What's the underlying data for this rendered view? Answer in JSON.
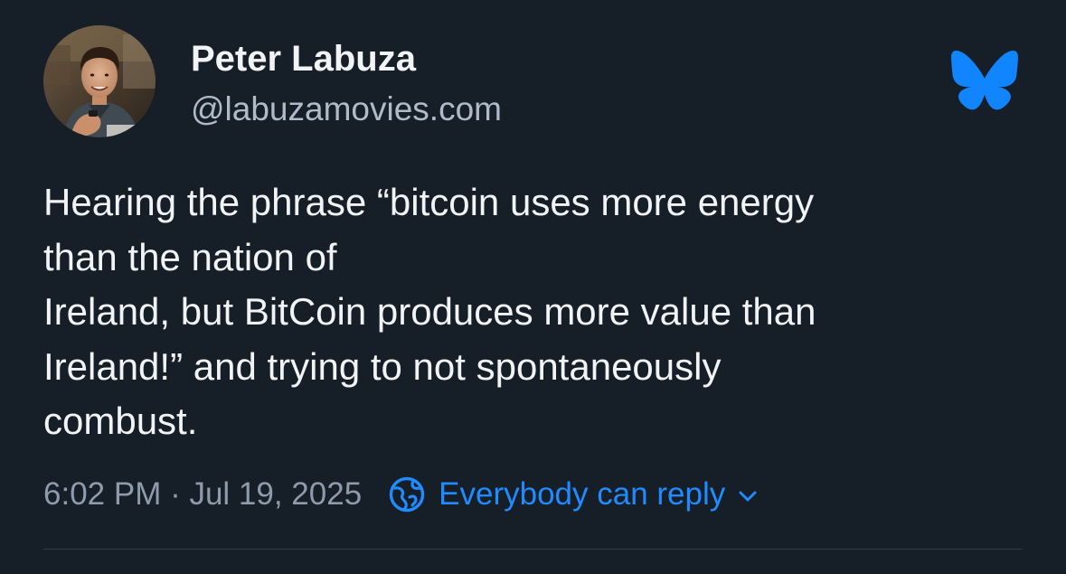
{
  "author": {
    "display_name": "Peter Labuza",
    "handle": "@labuzamovies.com"
  },
  "post": {
    "text_lines": [
      "Hearing the phrase “bitcoin uses more energy",
      "than the nation of",
      "Ireland, but BitCoin produces more value than",
      "Ireland!” and trying to not spontaneously",
      "combust."
    ]
  },
  "meta": {
    "timestamp": "6:02 PM · Jul 19, 2025",
    "reply_setting": "Everybody can reply"
  },
  "icons": {
    "app_logo": "bluesky-butterfly-icon",
    "reply_setting": "globe-icon",
    "dropdown": "chevron-down-icon"
  },
  "colors": {
    "background": "#161e27",
    "text_primary": "#f1f3f5",
    "text_secondary": "#aebbc9",
    "accent": "#208bfe"
  }
}
